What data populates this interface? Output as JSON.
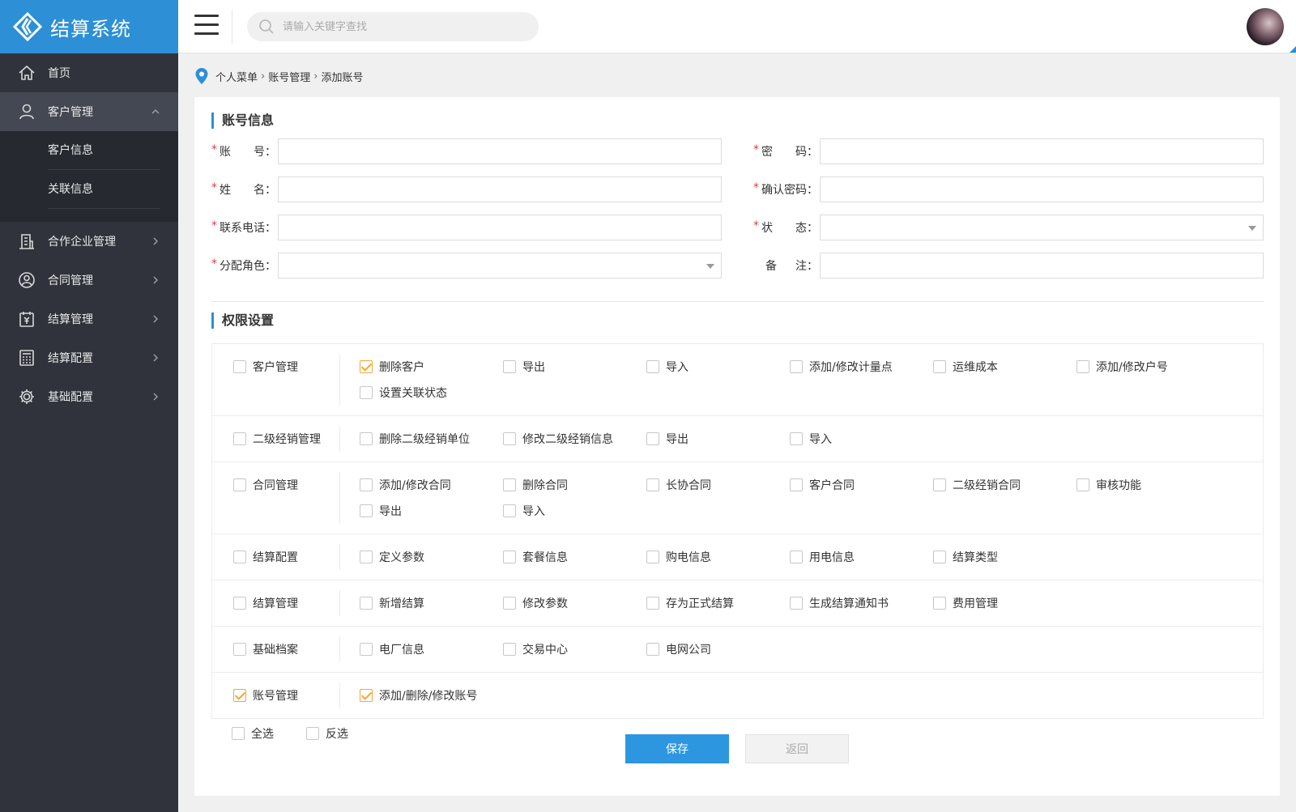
{
  "app": {
    "title": "结算系统"
  },
  "search": {
    "placeholder": "请输入关键字查找"
  },
  "sidebar": {
    "items": [
      {
        "label": "首页",
        "icon": "home-icon"
      },
      {
        "label": "客户管理",
        "icon": "user-icon",
        "expanded": true,
        "children": [
          {
            "label": "客户信息"
          },
          {
            "label": "关联信息"
          }
        ]
      },
      {
        "label": "合作企业管理",
        "icon": "building-icon"
      },
      {
        "label": "合同管理",
        "icon": "contract-icon"
      },
      {
        "label": "结算管理",
        "icon": "settlement-icon"
      },
      {
        "label": "结算配置",
        "icon": "calculator-icon"
      },
      {
        "label": "基础配置",
        "icon": "gear-icon"
      }
    ]
  },
  "breadcrumb": {
    "items": [
      "个人菜单",
      "账号管理",
      "添加账号"
    ],
    "separator": "›"
  },
  "account_section": {
    "title": "账号信息",
    "fields": {
      "account": {
        "label_a": "账",
        "label_b": "号",
        "value": ""
      },
      "password": {
        "label_a": "密",
        "label_b": "码",
        "value": ""
      },
      "name": {
        "label_a": "姓",
        "label_b": "名",
        "value": ""
      },
      "confirm_password": {
        "label": "确认密码",
        "value": ""
      },
      "phone": {
        "label": "联系电话",
        "value": ""
      },
      "status": {
        "label_a": "状",
        "label_b": "态",
        "value": ""
      },
      "role": {
        "label": "分配角色",
        "value": ""
      },
      "remark": {
        "label_a": "备",
        "label_b": "注",
        "value": ""
      }
    },
    "required_mark": "*",
    "colon": "："
  },
  "permission_section": {
    "title": "权限设置",
    "groups": [
      {
        "name": "客户管理",
        "checked": false,
        "items": [
          {
            "label": "删除客户",
            "checked": true
          },
          {
            "label": "导出",
            "checked": false
          },
          {
            "label": "导入",
            "checked": false
          },
          {
            "label": "添加/修改计量点",
            "checked": false
          },
          {
            "label": "运维成本",
            "checked": false
          },
          {
            "label": "添加/修改户号",
            "checked": false
          },
          {
            "label": "设置关联状态",
            "checked": false
          }
        ]
      },
      {
        "name": "二级经销管理",
        "checked": false,
        "items": [
          {
            "label": "删除二级经销单位",
            "checked": false
          },
          {
            "label": "修改二级经销信息",
            "checked": false
          },
          {
            "label": "导出",
            "checked": false
          },
          {
            "label": "导入",
            "checked": false
          }
        ]
      },
      {
        "name": "合同管理",
        "checked": false,
        "items": [
          {
            "label": "添加/修改合同",
            "checked": false
          },
          {
            "label": "删除合同",
            "checked": false
          },
          {
            "label": "长协合同",
            "checked": false
          },
          {
            "label": "客户合同",
            "checked": false
          },
          {
            "label": "二级经销合同",
            "checked": false
          },
          {
            "label": "审核功能",
            "checked": false
          },
          {
            "label": "导出",
            "checked": false
          },
          {
            "label": "导入",
            "checked": false
          }
        ]
      },
      {
        "name": "结算配置",
        "checked": false,
        "items": [
          {
            "label": "定义参数",
            "checked": false
          },
          {
            "label": "套餐信息",
            "checked": false
          },
          {
            "label": "购电信息",
            "checked": false
          },
          {
            "label": "用电信息",
            "checked": false
          },
          {
            "label": "结算类型",
            "checked": false
          }
        ]
      },
      {
        "name": "结算管理",
        "checked": false,
        "items": [
          {
            "label": "新增结算",
            "checked": false
          },
          {
            "label": "修改参数",
            "checked": false
          },
          {
            "label": "存为正式结算",
            "checked": false
          },
          {
            "label": "生成结算通知书",
            "checked": false
          },
          {
            "label": "费用管理",
            "checked": false
          }
        ]
      },
      {
        "name": "基础档案",
        "checked": false,
        "items": [
          {
            "label": "电厂信息",
            "checked": false
          },
          {
            "label": "交易中心",
            "checked": false
          },
          {
            "label": "电网公司",
            "checked": false
          }
        ]
      },
      {
        "name": "账号管理",
        "checked": true,
        "items": [
          {
            "label": "添加/删除/修改账号",
            "checked": true
          }
        ]
      }
    ]
  },
  "footer": {
    "select_all": "全选",
    "invert": "反选",
    "save_label": "保存",
    "back_label": "返回"
  },
  "colors": {
    "primary": "#2d8fd6",
    "sidebar": "#30333c",
    "checked": "#f3a636",
    "required": "#e4393c"
  }
}
